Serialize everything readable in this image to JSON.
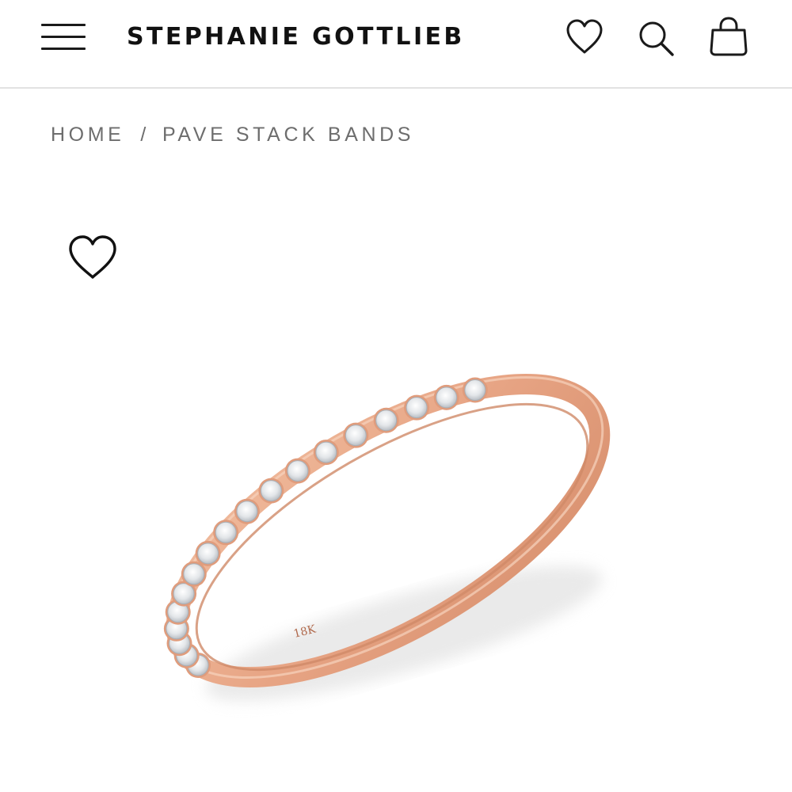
{
  "header": {
    "brand": "STEPHANIE GOTTLIEB",
    "icons": {
      "menu": "hamburger-menu-icon",
      "wishlist": "heart-icon",
      "search": "search-icon",
      "cart": "shopping-bag-icon"
    }
  },
  "breadcrumb": {
    "home": "HOME",
    "separator": "/",
    "current": "PAVE STACK BANDS"
  },
  "product": {
    "wishlist_icon": "heart-outline-icon",
    "image_subject": "rose gold pave diamond band",
    "band_stamp": "18K",
    "colors": {
      "metal": "#e9a988",
      "metal_dark": "#c98262",
      "diamond": "#e8eaec"
    }
  }
}
